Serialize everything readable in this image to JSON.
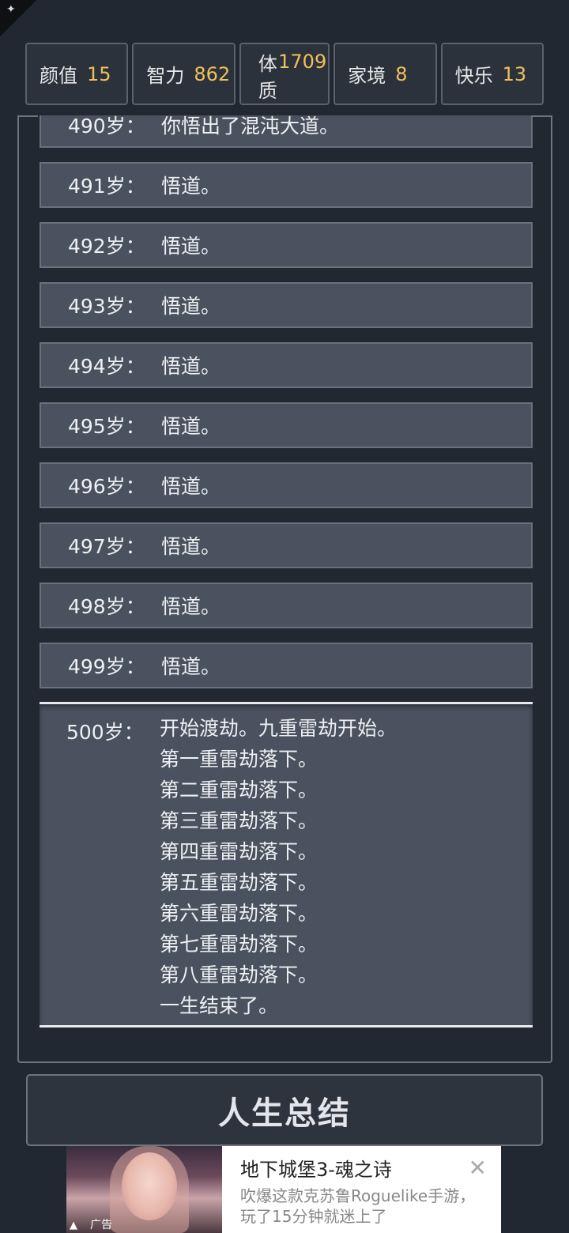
{
  "stats": [
    {
      "label": "颜值",
      "value": "15"
    },
    {
      "label": "智力",
      "value": "862"
    },
    {
      "label": "体质",
      "value": "1709"
    },
    {
      "label": "家境",
      "value": "8"
    },
    {
      "label": "快乐",
      "value": "13"
    }
  ],
  "log": {
    "entries": [
      {
        "age": "490岁：",
        "text": "你悟出了混沌大道。"
      },
      {
        "age": "491岁：",
        "text": "悟道。"
      },
      {
        "age": "492岁：",
        "text": "悟道。"
      },
      {
        "age": "493岁：",
        "text": "悟道。"
      },
      {
        "age": "494岁：",
        "text": "悟道。"
      },
      {
        "age": "495岁：",
        "text": "悟道。"
      },
      {
        "age": "496岁：",
        "text": "悟道。"
      },
      {
        "age": "497岁：",
        "text": "悟道。"
      },
      {
        "age": "498岁：",
        "text": "悟道。"
      },
      {
        "age": "499岁：",
        "text": "悟道。"
      }
    ],
    "final": {
      "age": "500岁：",
      "lines": [
        "开始渡劫。九重雷劫开始。",
        "第一重雷劫落下。",
        "第二重雷劫落下。",
        "第三重雷劫落下。",
        "第四重雷劫落下。",
        "第五重雷劫落下。",
        "第六重雷劫落下。",
        "第七重雷劫落下。",
        "第八重雷劫落下。",
        "一生结束了。"
      ]
    }
  },
  "summary_button": "人生总结",
  "ad": {
    "title": "地下城堡3-魂之诗",
    "description": "吹爆这款克苏鲁Roguelike手游，玩了15分钟就迷上了",
    "label": "广告",
    "close_icon": "close-icon"
  }
}
